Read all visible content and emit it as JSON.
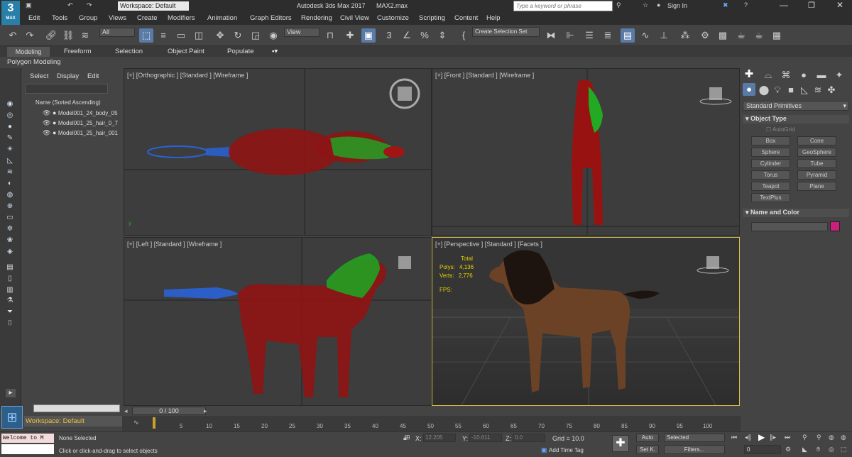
{
  "titlebar": {
    "app_title": "Autodesk 3ds Max 2017",
    "file_name": "MAX2.max",
    "workspace": "Workspace: Default",
    "search_placeholder": "Type a keyword or phrase",
    "sign_in": "Sign In",
    "logo_text": "3",
    "logo_sub": "MAX"
  },
  "menu": {
    "items": [
      "Edit",
      "Tools",
      "Group",
      "Views",
      "Create",
      "Modifiers",
      "Animation",
      "Graph Editors",
      "Rendering",
      "Civil View",
      "Customize",
      "Scripting",
      "Content",
      "Help"
    ]
  },
  "toolbar": {
    "filter": "All",
    "view_dropdown": "View",
    "selection_set": "Create Selection Set"
  },
  "ribbon": {
    "tabs": [
      "Modeling",
      "Freeform",
      "Selection",
      "Object Paint",
      "Populate"
    ],
    "active_tab": "Modeling",
    "panel_label": "Polygon Modeling"
  },
  "scene_explorer": {
    "menus": [
      "Select",
      "Display",
      "Edit"
    ],
    "column_header": "Name (Sorted Ascending)",
    "objects": [
      "Model001_24_body_05",
      "Model001_25_hair_0_7",
      "Model001_25_hair_001"
    ],
    "workspace_footer": "Workspace: Default"
  },
  "viewports": {
    "top_left": "[+] [Orthographic ] [Standard ] [Wireframe ]",
    "top_right": "[+] [Front ] [Standard ] [Wireframe ]",
    "bottom_left": "[+] [Left ] [Standard ] [Wireframe ]",
    "bottom_right": "[+] [Perspective ] [Standard ] [Facets ]"
  },
  "stats": {
    "total_label": "Total",
    "polys_label": "Polys:",
    "polys": "4,136",
    "verts_label": "Verts:",
    "verts": "2,776",
    "fps_label": "FPS:"
  },
  "command_panel": {
    "dropdown": "Standard Primitives",
    "object_type_title": "Object Type",
    "autogrid": "AutoGrid",
    "primitives": [
      "Box",
      "Cone",
      "Sphere",
      "GeoSphere",
      "Cylinder",
      "Tube",
      "Torus",
      "Pyramid",
      "Teapot",
      "Plane",
      "TextPlus"
    ],
    "name_color_title": "Name and Color",
    "swatch_color": "#c8207c"
  },
  "timeline": {
    "frame_counter": "0 / 100",
    "ticks": [
      "0",
      "5",
      "10",
      "15",
      "20",
      "25",
      "30",
      "35",
      "40",
      "45",
      "50",
      "55",
      "60",
      "65",
      "70",
      "75",
      "80",
      "85",
      "90",
      "95",
      "100"
    ]
  },
  "status": {
    "maxscript": "Welcome to M",
    "selection": "None Selected",
    "prompt": "Click or click-and-drag to select objects",
    "x_label": "X:",
    "x": "12.205",
    "y_label": "Y:",
    "y": "-10.611",
    "z_label": "Z:",
    "z": "0.0",
    "grid": "Grid = 10.0",
    "add_time_tag": "Add Time Tag",
    "auto": "Auto",
    "set_key": "Set K.",
    "selected": "Selected",
    "filters": "Filters...",
    "frame": "0"
  }
}
